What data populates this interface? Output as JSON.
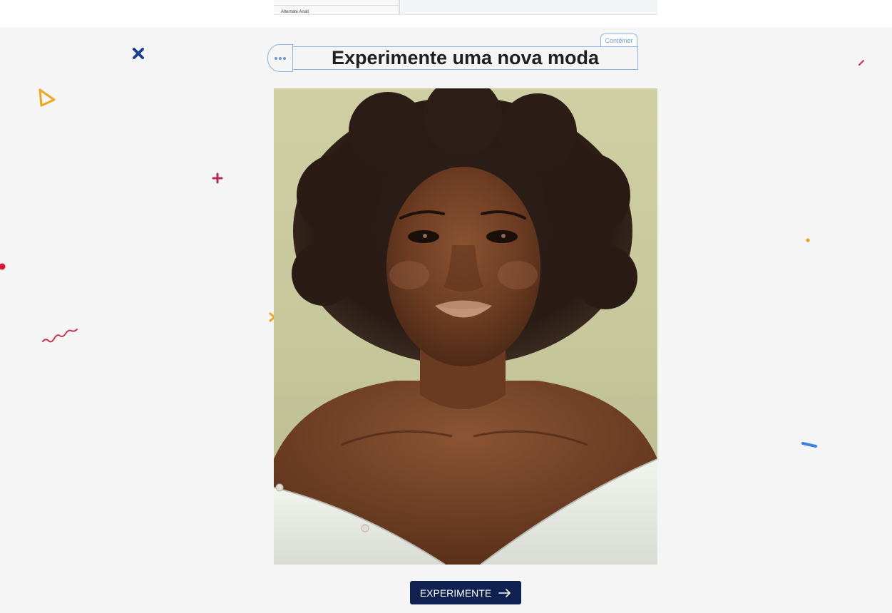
{
  "preview": {
    "label": "Alternate Analt"
  },
  "editor": {
    "container_tag": "Contêiner",
    "handle_icon": "more-dots-icon"
  },
  "hero": {
    "title": "Experimente uma nova moda",
    "image_description": "portrait-photo"
  },
  "cta": {
    "label": "EXPERIMENTE",
    "icon": "arrow-right-icon"
  },
  "colors": {
    "stage_background": "#f5f5f5",
    "button_background": "#0e2150",
    "editor_outline": "#8ab4e8",
    "title_text": "#1f1f1f"
  }
}
